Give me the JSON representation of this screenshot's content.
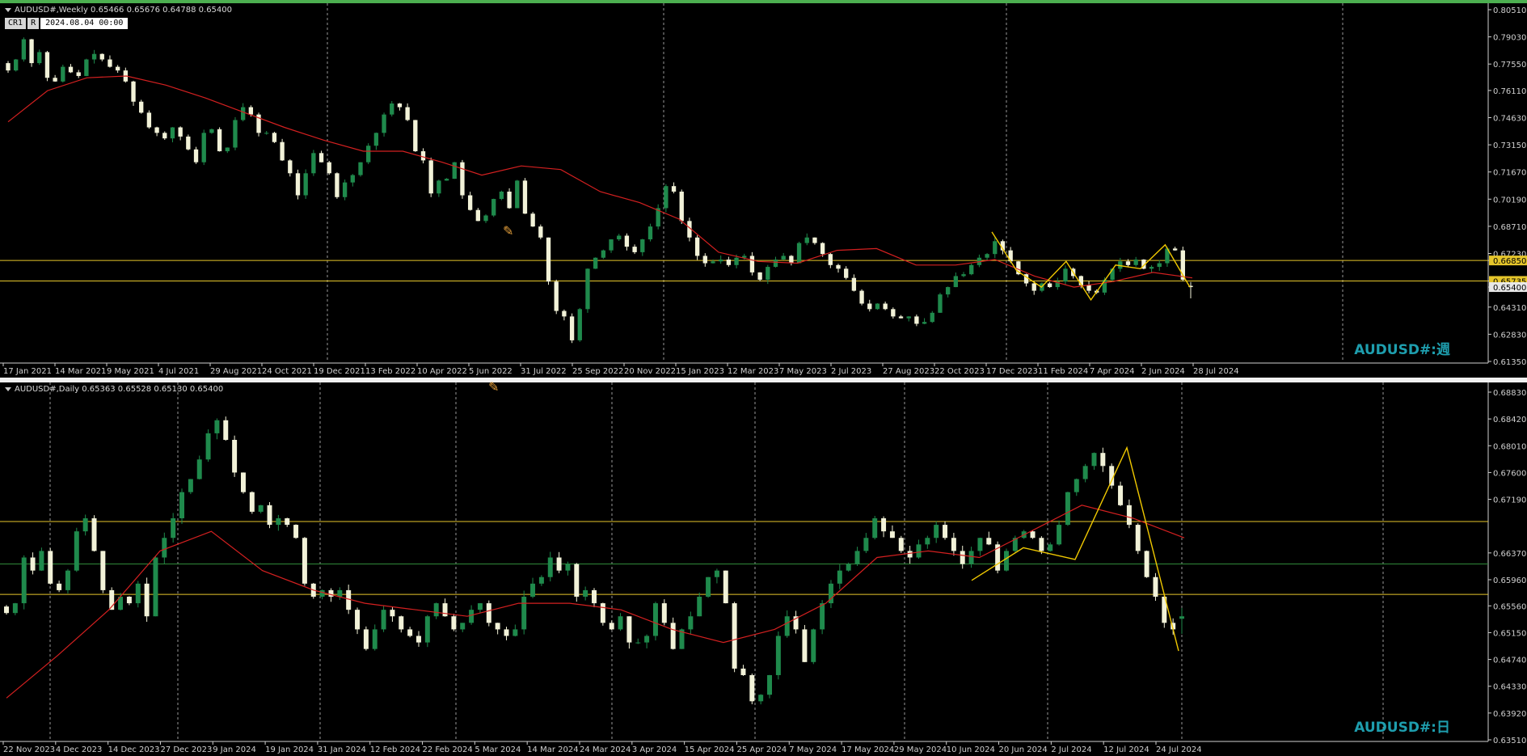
{
  "panes": [
    {
      "id": "weekly",
      "header": "AUDUSD#,Weekly  0.65466 0.65676 0.64788 0.65400",
      "watermark": "AUDUSD#:週",
      "controls": {
        "cr": "CR1",
        "r": "R",
        "datetime": "2024.08.04 00:00"
      },
      "price_axis": [
        "0.80510",
        "0.79030",
        "0.77550",
        "0.76110",
        "0.74630",
        "0.73150",
        "0.71670",
        "0.70190",
        "0.68710",
        "0.67230",
        "0.66850",
        "0.65735",
        "0.65400",
        "0.64310",
        "0.62830",
        "0.61350"
      ],
      "time_axis": [
        "17 Jan 2021",
        "14 Mar 2021",
        "9 May 2021",
        "4 Jul 2021",
        "29 Aug 2021",
        "24 Oct 2021",
        "19 Dec 2021",
        "13 Feb 2022",
        "10 Apr 2022",
        "5 Jun 2022",
        "31 Jul 2022",
        "25 Sep 2022",
        "20 Nov 2022",
        "15 Jan 2023",
        "12 Mar 2023",
        "7 May 2023",
        "2 Jul 2023",
        "27 Aug 2023",
        "22 Oct 2023",
        "17 Dec 2023",
        "11 Feb 2024",
        "7 Apr 2024",
        "2 Jun 2024",
        "28 Jul 2024"
      ],
      "levels": [
        {
          "price": "0.66850",
          "color": "#e6c62b"
        },
        {
          "price": "0.65735",
          "color": "#e6c62b"
        }
      ],
      "current_price": "0.65400"
    },
    {
      "id": "daily",
      "header": "AUDUSD#,Daily  0.65363 0.65528 0.65130 0.65400",
      "watermark": "AUDUSD#:日",
      "price_axis": [
        "0.68830",
        "0.68420",
        "0.68010",
        "0.67600",
        "0.67190",
        "0.66370",
        "0.65960",
        "0.65560",
        "0.65150",
        "0.64740",
        "0.64330",
        "0.63920",
        "0.63510"
      ],
      "time_axis": [
        "22 Nov 2023",
        "4 Dec 2023",
        "14 Dec 2023",
        "27 Dec 2023",
        "9 Jan 2024",
        "19 Jan 2024",
        "31 Jan 2024",
        "12 Feb 2024",
        "22 Feb 2024",
        "5 Mar 2024",
        "14 Mar 2024",
        "24 Mar 2024",
        "3 Apr 2024",
        "15 Apr 2024",
        "25 Apr 2024",
        "7 May 2024",
        "17 May 2024",
        "29 May 2024",
        "10 Jun 2024",
        "20 Jun 2024",
        "2 Jul 2024",
        "12 Jul 2024",
        "24 Jul 2024"
      ],
      "levels": [
        {
          "price": "0.66850",
          "color": "#e6c62b"
        },
        {
          "price": "0.66201",
          "color": "#2f8a3a"
        },
        {
          "price": "0.65735",
          "color": "#e6c62b"
        }
      ],
      "current_price": "0.65400"
    }
  ],
  "colors": {
    "bull": "#1f8a4c",
    "bear": "#f2f2d8",
    "ma": "#d42020",
    "zigzag": "#f0c800",
    "grid": "#bfbfbf",
    "axis_text": "#cfcfcf",
    "bg": "#000000"
  },
  "chart_data": [
    {
      "type": "candlestick",
      "title": "AUDUSD#,Weekly",
      "ylim": [
        0.6135,
        0.8051
      ],
      "ohlc_last": {
        "open": 0.65466,
        "high": 0.65676,
        "low": 0.64788,
        "close": 0.654
      },
      "x_labels": [
        "17 Jan 2021",
        "14 Mar 2021",
        "9 May 2021",
        "4 Jul 2021",
        "29 Aug 2021",
        "24 Oct 2021",
        "19 Dec 2021",
        "13 Feb 2022",
        "10 Apr 2022",
        "5 Jun 2022",
        "31 Jul 2022",
        "25 Sep 2022",
        "20 Nov 2022",
        "15 Jan 2023",
        "12 Mar 2023",
        "7 May 2023",
        "2 Jul 2023",
        "27 Aug 2023",
        "22 Oct 2023",
        "17 Dec 2023",
        "11 Feb 2024",
        "7 Apr 2024",
        "2 Jun 2024",
        "28 Jul 2024"
      ],
      "close_path": [
        0.772,
        0.778,
        0.789,
        0.776,
        0.782,
        0.768,
        0.766,
        0.774,
        0.771,
        0.769,
        0.778,
        0.781,
        0.778,
        0.774,
        0.772,
        0.766,
        0.755,
        0.749,
        0.741,
        0.738,
        0.735,
        0.741,
        0.736,
        0.729,
        0.722,
        0.738,
        0.74,
        0.728,
        0.73,
        0.745,
        0.752,
        0.748,
        0.738,
        0.738,
        0.733,
        0.723,
        0.716,
        0.704,
        0.716,
        0.727,
        0.722,
        0.716,
        0.703,
        0.711,
        0.715,
        0.722,
        0.731,
        0.738,
        0.748,
        0.754,
        0.752,
        0.745,
        0.728,
        0.723,
        0.705,
        0.712,
        0.713,
        0.722,
        0.704,
        0.696,
        0.69,
        0.693,
        0.702,
        0.706,
        0.697,
        0.712,
        0.694,
        0.687,
        0.681,
        0.657,
        0.641,
        0.638,
        0.625,
        0.642,
        0.664,
        0.67,
        0.674,
        0.68,
        0.682,
        0.676,
        0.673,
        0.68,
        0.687,
        0.697,
        0.709,
        0.706,
        0.69,
        0.681,
        0.671,
        0.667,
        0.668,
        0.669,
        0.666,
        0.67,
        0.671,
        0.662,
        0.658,
        0.665,
        0.669,
        0.671,
        0.667,
        0.678,
        0.681,
        0.678,
        0.672,
        0.666,
        0.664,
        0.659,
        0.652,
        0.645,
        0.642,
        0.645,
        0.642,
        0.638,
        0.637,
        0.638,
        0.634,
        0.635,
        0.64,
        0.65,
        0.654,
        0.66,
        0.661,
        0.666,
        0.67,
        0.672,
        0.679,
        0.674,
        0.668,
        0.661,
        0.656,
        0.652,
        0.656,
        0.654,
        0.657,
        0.664,
        0.66,
        0.655,
        0.652,
        0.651,
        0.658,
        0.664,
        0.668,
        0.666,
        0.669,
        0.664,
        0.665,
        0.667,
        0.675,
        0.674,
        0.658,
        0.654
      ],
      "series": [
        {
          "name": "Moving Average",
          "values_approx": [
            0.744,
            0.761,
            0.768,
            0.769,
            0.764,
            0.757,
            0.749,
            0.741,
            0.734,
            0.728,
            0.728,
            0.722,
            0.715,
            0.72,
            0.718,
            0.706,
            0.7,
            0.691,
            0.673,
            0.668,
            0.667,
            0.674,
            0.675,
            0.666,
            0.666,
            0.669,
            0.66,
            0.654,
            0.657,
            0.662,
            0.659
          ]
        },
        {
          "name": "ZigZag",
          "values_approx": [
            0.684,
            0.663,
            0.654,
            0.668,
            0.647,
            0.666,
            0.664,
            0.677,
            0.654
          ]
        }
      ],
      "horizontal_levels": [
        0.6685,
        0.65735
      ]
    },
    {
      "type": "candlestick",
      "title": "AUDUSD#,Daily",
      "ylim": [
        0.6351,
        0.6883
      ],
      "ohlc_last": {
        "open": 0.65363,
        "high": 0.65528,
        "low": 0.6513,
        "close": 0.654
      },
      "x_labels": [
        "22 Nov 2023",
        "4 Dec 2023",
        "14 Dec 2023",
        "27 Dec 2023",
        "9 Jan 2024",
        "19 Jan 2024",
        "31 Jan 2024",
        "12 Feb 2024",
        "22 Feb 2024",
        "5 Mar 2024",
        "14 Mar 2024",
        "24 Mar 2024",
        "3 Apr 2024",
        "15 Apr 2024",
        "25 Apr 2024",
        "7 May 2024",
        "17 May 2024",
        "29 May 2024",
        "10 Jun 2024",
        "20 Jun 2024",
        "2 Jul 2024",
        "12 Jul 2024",
        "24 Jul 2024"
      ],
      "close_path": [
        0.6545,
        0.656,
        0.663,
        0.661,
        0.664,
        0.659,
        0.658,
        0.661,
        0.667,
        0.669,
        0.664,
        0.658,
        0.655,
        0.657,
        0.656,
        0.659,
        0.654,
        0.663,
        0.666,
        0.669,
        0.673,
        0.675,
        0.678,
        0.682,
        0.684,
        0.681,
        0.676,
        0.673,
        0.67,
        0.671,
        0.668,
        0.669,
        0.668,
        0.666,
        0.659,
        0.657,
        0.658,
        0.657,
        0.658,
        0.655,
        0.652,
        0.649,
        0.652,
        0.655,
        0.654,
        0.652,
        0.651,
        0.65,
        0.654,
        0.656,
        0.654,
        0.652,
        0.653,
        0.655,
        0.656,
        0.653,
        0.652,
        0.651,
        0.652,
        0.657,
        0.659,
        0.66,
        0.663,
        0.661,
        0.662,
        0.657,
        0.658,
        0.656,
        0.653,
        0.652,
        0.654,
        0.65,
        0.65,
        0.651,
        0.656,
        0.653,
        0.649,
        0.652,
        0.654,
        0.657,
        0.66,
        0.661,
        0.656,
        0.646,
        0.645,
        0.641,
        0.642,
        0.645,
        0.651,
        0.654,
        0.652,
        0.647,
        0.652,
        0.656,
        0.659,
        0.661,
        0.662,
        0.664,
        0.666,
        0.669,
        0.667,
        0.666,
        0.664,
        0.663,
        0.665,
        0.666,
        0.668,
        0.666,
        0.664,
        0.662,
        0.664,
        0.666,
        0.665,
        0.661,
        0.664,
        0.666,
        0.667,
        0.666,
        0.664,
        0.665,
        0.668,
        0.673,
        0.675,
        0.677,
        0.679,
        0.677,
        0.674,
        0.671,
        0.668,
        0.664,
        0.66,
        0.657,
        0.653,
        0.652,
        0.655
      ],
      "series": [
        {
          "name": "Moving Average",
          "values_approx": [
            0.6415,
            0.648,
            0.655,
            0.664,
            0.667,
            0.661,
            0.658,
            0.656,
            0.655,
            0.654,
            0.656,
            0.656,
            0.655,
            0.652,
            0.65,
            0.652,
            0.656,
            0.663,
            0.664,
            0.663,
            0.667,
            0.671,
            0.669,
            0.666
          ]
        },
        {
          "name": "ZigZag",
          "values_approx": [
            0.6595,
            0.6645,
            0.6627,
            0.6798,
            0.6487
          ]
        }
      ],
      "horizontal_levels": [
        0.6685,
        0.66201,
        0.65735
      ]
    }
  ]
}
